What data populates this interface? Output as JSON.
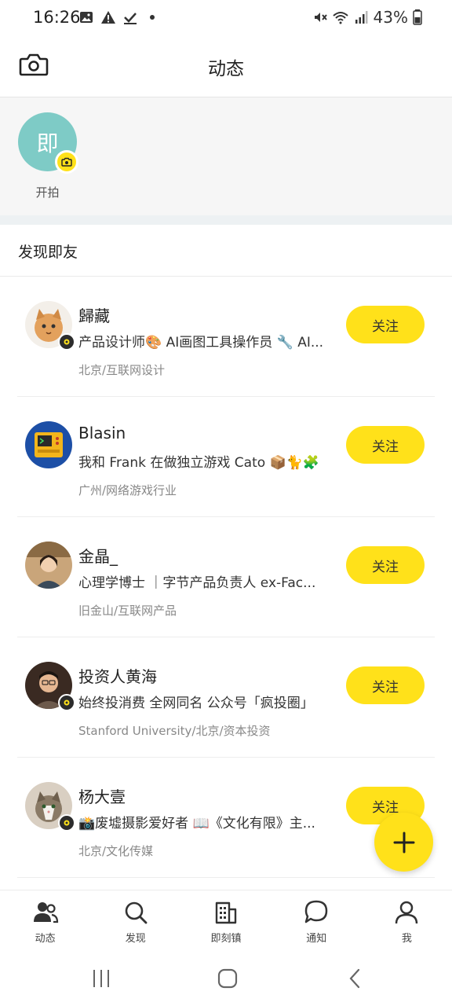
{
  "status_bar": {
    "time": "16:26",
    "battery": "43%"
  },
  "header": {
    "title": "动态",
    "camera_icon": "camera-icon"
  },
  "story": {
    "avatar_text": "即",
    "label": "开拍"
  },
  "discover": {
    "title": "发现即友"
  },
  "friends": [
    {
      "name": "歸藏",
      "bio": "产品设计师🎨 AI画图工具操作员 🔧 AI...",
      "meta": "北京/互联网设计",
      "follow": "关注"
    },
    {
      "name": "Blasin",
      "bio": "我和 Frank 在做独立游戏 Cato 📦🐈🧩",
      "meta": "广州/网络游戏行业",
      "follow": "关注"
    },
    {
      "name": "金晶_",
      "bio": "心理学博士 ｜字节产品负责人 ex-Fac...",
      "meta": "旧金山/互联网产品",
      "follow": "关注"
    },
    {
      "name": "投资人黄海",
      "bio": "始终投消费 全网同名 公众号「疯投圈」",
      "meta": "Stanford University/北京/资本投资",
      "follow": "关注"
    },
    {
      "name": "杨大壹",
      "bio": "📸废墟摄影爱好者 📖《文化有限》主...",
      "meta": "北京/文化传媒",
      "follow": "关注"
    }
  ],
  "bottom_nav": [
    {
      "label": "动态",
      "icon": "people-icon"
    },
    {
      "label": "发现",
      "icon": "search-icon"
    },
    {
      "label": "即刻镇",
      "icon": "buildings-icon"
    },
    {
      "label": "通知",
      "icon": "chat-bubble-icon"
    },
    {
      "label": "我",
      "icon": "person-icon"
    }
  ],
  "colors": {
    "accent": "#ffe11a",
    "story_avatar": "#7ecbc6"
  }
}
